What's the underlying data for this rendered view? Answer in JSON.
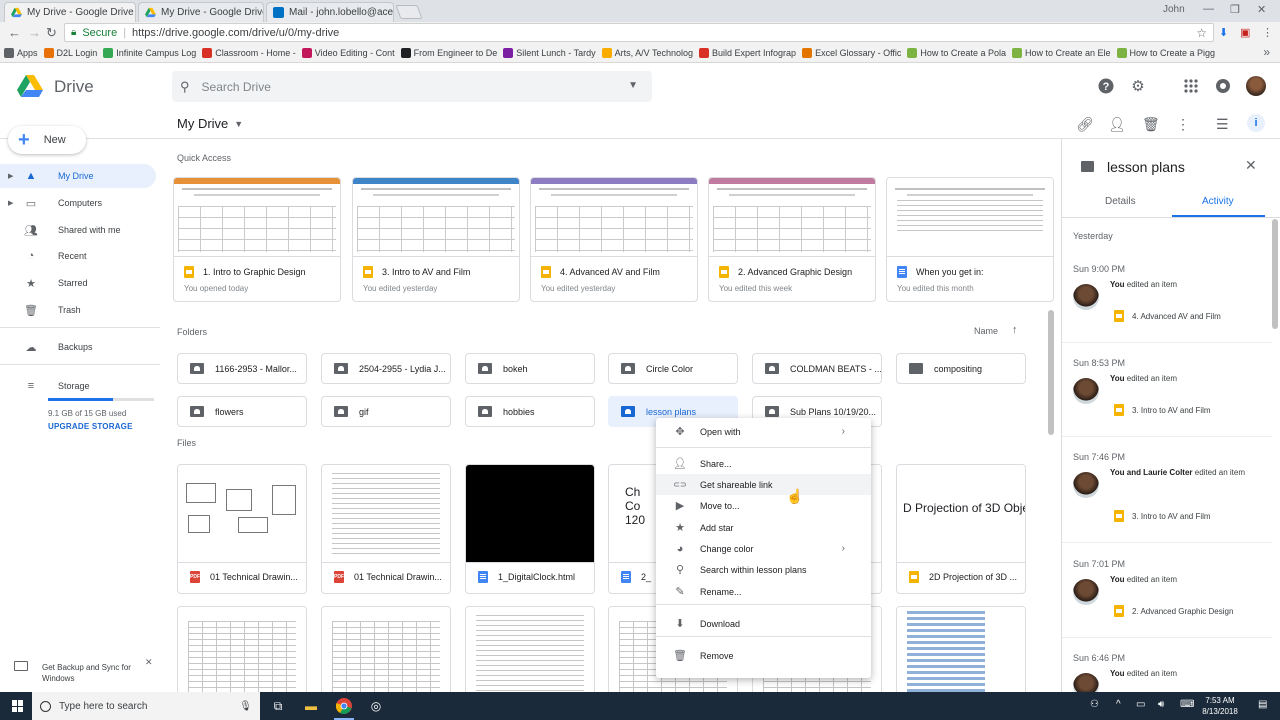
{
  "browser": {
    "tabs": [
      {
        "title": "My Drive - Google Drive",
        "active": true
      },
      {
        "title": "My Drive - Google Drive",
        "active": false
      },
      {
        "title": "Mail - john.lobello@acen",
        "active": false
      }
    ],
    "user": "John",
    "secure_label": "Secure",
    "url": "https://drive.google.com/drive/u/0/my-drive",
    "bookmarks": [
      {
        "label": "Apps",
        "color": "#5f6368"
      },
      {
        "label": "D2L Login",
        "color": "#e8710a"
      },
      {
        "label": "Infinite Campus Log",
        "color": "#34a853"
      },
      {
        "label": "Classroom - Home -",
        "color": "#d93025"
      },
      {
        "label": "Video Editing - Cont",
        "color": "#c2185b"
      },
      {
        "label": "From Engineer to De",
        "color": "#202124"
      },
      {
        "label": "Silent Lunch - Tardy",
        "color": "#7b1fa2"
      },
      {
        "label": "Arts, A/V Technolog",
        "color": "#f9ab00"
      },
      {
        "label": "Build Expert Infograp",
        "color": "#d93025"
      },
      {
        "label": "Excel Glossary - Offic",
        "color": "#e37400"
      },
      {
        "label": "How to Create a Pola",
        "color": "#7cb342"
      },
      {
        "label": "How to Create an Ele",
        "color": "#7cb342"
      },
      {
        "label": "How to Create a Pigg",
        "color": "#7cb342"
      }
    ]
  },
  "header": {
    "app_name": "Drive",
    "search_placeholder": "Search Drive"
  },
  "toolbar": {
    "title": "My Drive"
  },
  "sidebar": {
    "new_label": "New",
    "items": [
      {
        "label": "My Drive",
        "icon": "drive-icon",
        "active": true
      },
      {
        "label": "Computers",
        "icon": "computer-icon",
        "active": false
      },
      {
        "label": "Shared with me",
        "icon": "people-icon",
        "active": false
      },
      {
        "label": "Recent",
        "icon": "clock-icon",
        "active": false
      },
      {
        "label": "Starred",
        "icon": "star-icon",
        "active": false
      },
      {
        "label": "Trash",
        "icon": "trash-icon",
        "active": false
      },
      {
        "label": "Backups",
        "icon": "cloud-icon",
        "active": false
      },
      {
        "label": "Storage",
        "icon": "storage-icon",
        "active": false
      }
    ],
    "storage_used": "9.1 GB of 15 GB used",
    "storage_fraction": 0.61,
    "upgrade_label": "UPGRADE STORAGE",
    "backup_prompt": "Get Backup and Sync for Windows"
  },
  "main": {
    "quick_access_label": "Quick Access",
    "quick_access": [
      {
        "name": "1. Intro to Graphic Design",
        "sub": "You opened today",
        "type": "slides",
        "band": "#e69138"
      },
      {
        "name": "3. Intro to AV and Film",
        "sub": "You edited yesterday",
        "type": "slides",
        "band": "#3d85c6"
      },
      {
        "name": "4. Advanced AV and Film",
        "sub": "You edited yesterday",
        "type": "slides",
        "band": "#8e7cc3"
      },
      {
        "name": "2. Advanced Graphic Design",
        "sub": "You edited this week",
        "type": "slides",
        "band": "#c27ba0"
      },
      {
        "name": "When you get in:",
        "sub": "You edited this month",
        "type": "doc",
        "band": "#ffffff"
      }
    ],
    "folders_label": "Folders",
    "sort_label": "Name",
    "folders": [
      {
        "name": "1166-2953 - Mallor...",
        "selected": false
      },
      {
        "name": "2504-2955 - Lydia J...",
        "selected": false
      },
      {
        "name": "bokeh",
        "selected": false
      },
      {
        "name": "Circle Color",
        "selected": false
      },
      {
        "name": "COLDMAN BEATS - ...",
        "selected": false
      },
      {
        "name": "compositing",
        "selected": false
      },
      {
        "name": "flowers",
        "selected": false
      },
      {
        "name": "gif",
        "selected": false
      },
      {
        "name": "hobbies",
        "selected": false
      },
      {
        "name": "lesson plans",
        "selected": true
      },
      {
        "name": "Sub Plans 10/19/20...",
        "selected": false
      }
    ],
    "files_label": "Files",
    "files": [
      {
        "name": "01 Technical Drawin...",
        "type": "pdf"
      },
      {
        "name": "01 Technical Drawin...",
        "type": "pdf"
      },
      {
        "name": "1_DigitalClock.html",
        "type": "doc"
      },
      {
        "name": "2_",
        "type": "doc",
        "thumb_text": "Ch Co 120"
      },
      {
        "name": "",
        "type": "doc"
      },
      {
        "name": "2D Projection of 3D ...",
        "type": "slides",
        "thumb_text": "D Projection of 3D Obje"
      }
    ]
  },
  "context_menu": {
    "items": [
      {
        "label": "Open with",
        "icon": "move-arrows-icon",
        "submenu": true
      },
      {
        "label": "Share...",
        "icon": "share-person-icon",
        "submenu": false
      },
      {
        "label": "Get shareable link",
        "icon": "link-icon",
        "submenu": false,
        "hover": true
      },
      {
        "label": "Move to...",
        "icon": "move-folder-icon",
        "submenu": false
      },
      {
        "label": "Add star",
        "icon": "star-icon",
        "submenu": false
      },
      {
        "label": "Change color",
        "icon": "palette-icon",
        "submenu": true
      },
      {
        "label": "Search within lesson plans",
        "icon": "search-icon",
        "submenu": false
      },
      {
        "label": "Rename...",
        "icon": "pencil-icon",
        "submenu": false
      },
      {
        "label": "Download",
        "icon": "download-icon",
        "submenu": false
      },
      {
        "label": "Remove",
        "icon": "trash-icon",
        "submenu": false
      }
    ]
  },
  "details": {
    "title": "lesson plans",
    "tabs": [
      "Details",
      "Activity"
    ],
    "active_tab": "Activity",
    "group_label": "Yesterday",
    "activities": [
      {
        "time": "Sun 9:00 PM",
        "actor": "You",
        "text": " edited an item",
        "file": "4. Advanced AV and Film"
      },
      {
        "time": "Sun 8:53 PM",
        "actor": "You",
        "text": " edited an item",
        "file": "3. Intro to AV and Film"
      },
      {
        "time": "Sun 7:46 PM",
        "actor": "You and Laurie Colter",
        "text": " edited an item",
        "file": "3. Intro to AV and Film"
      },
      {
        "time": "Sun 7:01 PM",
        "actor": "You",
        "text": " edited an item",
        "file": "2. Advanced Graphic Design"
      },
      {
        "time": "Sun 6:46 PM",
        "actor": "You",
        "text": " edited an item",
        "file": ""
      }
    ]
  },
  "taskbar": {
    "search_placeholder": "Type here to search",
    "time": "7:53 AM",
    "date": "8/13/2018"
  }
}
